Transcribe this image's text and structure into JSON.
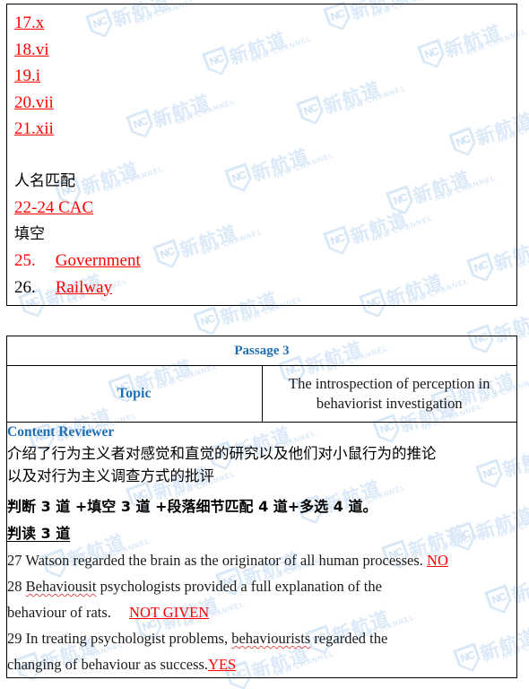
{
  "answers_block": {
    "matching_headings_answers": [
      {
        "number": "17.",
        "answer": "x"
      },
      {
        "number": "18.",
        "answer": "vi"
      },
      {
        "number": "19.",
        "answer": "i"
      },
      {
        "number": "20.",
        "answer": "vii"
      },
      {
        "number": "21.",
        "answer": "xii"
      }
    ],
    "name_matching_label": "人名匹配",
    "name_matching_answer": "22-24 CAC  ",
    "fill_blank_label": "填空",
    "fill_blank_answers": [
      {
        "number": "25.",
        "answer": "Government"
      },
      {
        "number": "26.",
        "answer": "Railway"
      }
    ]
  },
  "passage": {
    "header": "Passage 3",
    "topic_label": "Topic",
    "topic_value": "The introspection of perception in behaviorist investigation",
    "content_reviewer_label": "Content Reviewer",
    "content_reviewer_text_line1": "介绍了行为主义者对感觉和直觉的研究以及他们对小鼠行为的推论",
    "content_reviewer_text_line2": "以及对行为主义调查方式的批评",
    "question_breakdown": "判断 3 道  +填空  3 道  +段落细节匹配 4 道+多选 4 道。",
    "section_label": "判读  3  道 ",
    "questions": [
      {
        "number": "27",
        "text_a": "Watson regarded the brain as the originator of all human processes.",
        "misspelled": "",
        "text_b": "",
        "answer": "NO",
        "single_line": true
      },
      {
        "number": "28",
        "text_a": "",
        "misspelled": "Behaviousit",
        "text_b": " psychologists provided a full explanation of the",
        "text_wrap": "behaviour of rats.",
        "answer": "NOT GIVEN",
        "single_line": false
      },
      {
        "number": "29",
        "text_a": "In treating psychologist problems, ",
        "misspelled": "behaviourists",
        "text_b": " regarded the",
        "text_wrap": "changing of behaviour as success.",
        "answer": "YES",
        "single_line": false
      }
    ]
  },
  "watermark": {
    "chinese": "新航道",
    "english": "NEW CHANNEL",
    "mark": "NC",
    "color": "#dbe9f8"
  },
  "colors": {
    "answer_red": "#ff0000",
    "header_blue": "#1f6fb5",
    "border": "#000000",
    "watermark": "#dbe9f8"
  }
}
